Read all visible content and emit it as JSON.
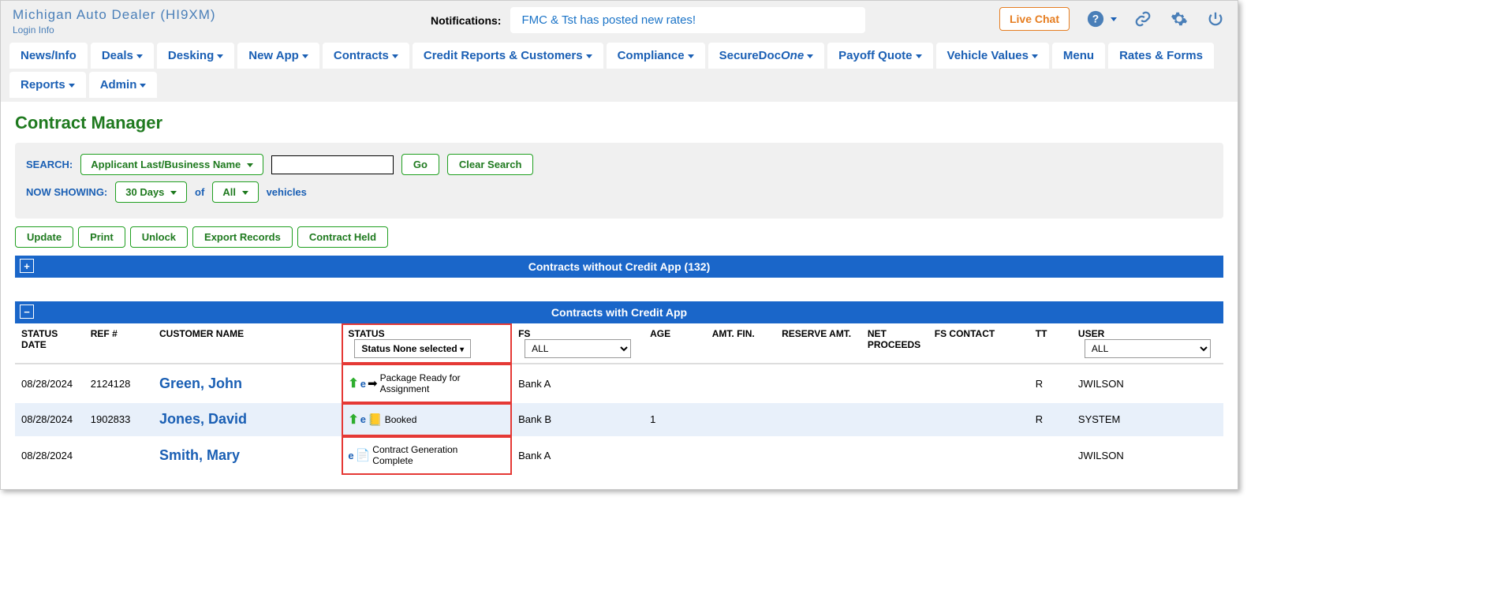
{
  "header": {
    "dealer_name": "Michigan  Auto  Dealer   (HI9XM)",
    "login_info": "Login  Info",
    "notifications_label": "Notifications:",
    "notification_text": "FMC & Tst has posted new rates!",
    "live_chat": "Live Chat"
  },
  "nav": {
    "items": [
      {
        "label": "News/Info",
        "dd": false
      },
      {
        "label": "Deals",
        "dd": true
      },
      {
        "label": "Desking",
        "dd": true
      },
      {
        "label": "New App",
        "dd": true
      },
      {
        "label": "Contracts",
        "dd": true
      },
      {
        "label": "Credit Reports & Customers",
        "dd": true
      },
      {
        "label": "Compliance",
        "dd": true
      },
      {
        "label": "SecureDoc",
        "dd": true,
        "italic_suffix": "One"
      },
      {
        "label": "Payoff Quote",
        "dd": true
      },
      {
        "label": "Vehicle Values",
        "dd": true
      },
      {
        "label": "Menu",
        "dd": false
      },
      {
        "label": "Rates & Forms",
        "dd": false
      },
      {
        "label": "Reports",
        "dd": true
      },
      {
        "label": "Admin",
        "dd": true
      }
    ]
  },
  "page": {
    "title": "Contract Manager",
    "search_label": "SEARCH:",
    "search_type": "Applicant Last/Business Name",
    "go": "Go",
    "clear": "Clear Search",
    "now_showing_label": "NOW SHOWING:",
    "days": "30 Days",
    "of": "of",
    "all": "All",
    "vehicles": "vehicles"
  },
  "actions": {
    "update": "Update",
    "print": "Print",
    "unlock": "Unlock",
    "export": "Export Records",
    "held": "Contract Held"
  },
  "sections": {
    "without_credit": "Contracts without Credit App (132)",
    "with_credit": "Contracts with Credit App"
  },
  "columns": {
    "status_date": "STATUS DATE",
    "ref": "REF #",
    "customer": "CUSTOMER NAME",
    "status": "STATUS",
    "status_dd": "Status None selected",
    "fs": "FS",
    "fs_all": "ALL",
    "age": "AGE",
    "amt_fin": "AMT. FIN.",
    "reserve": "RESERVE AMT.",
    "net": "NET PROCEEDS",
    "fs_contact": "FS CONTACT",
    "tt": "TT",
    "user": "USER",
    "user_all": "ALL"
  },
  "rows": [
    {
      "date": "08/28/2024",
      "ref": "2124128",
      "cust": "Green, John",
      "up": true,
      "e": true,
      "icon": "arrow-right",
      "status": "Package Ready for Assignment",
      "fs": "Bank A",
      "age": "",
      "tt": "R",
      "user": "JWILSON",
      "alt": false
    },
    {
      "date": "08/28/2024",
      "ref": "1902833",
      "cust": "Jones, David",
      "up": true,
      "e": true,
      "icon": "booked",
      "status": "Booked",
      "fs": "Bank B",
      "age": "1",
      "tt": "R",
      "user": "SYSTEM",
      "alt": true
    },
    {
      "date": "08/28/2024",
      "ref": "",
      "cust": "Smith, Mary",
      "up": false,
      "e": true,
      "icon": "doc",
      "status": "Contract Generation Complete",
      "fs": "Bank A",
      "age": "",
      "tt": "",
      "user": "JWILSON",
      "alt": false
    }
  ]
}
